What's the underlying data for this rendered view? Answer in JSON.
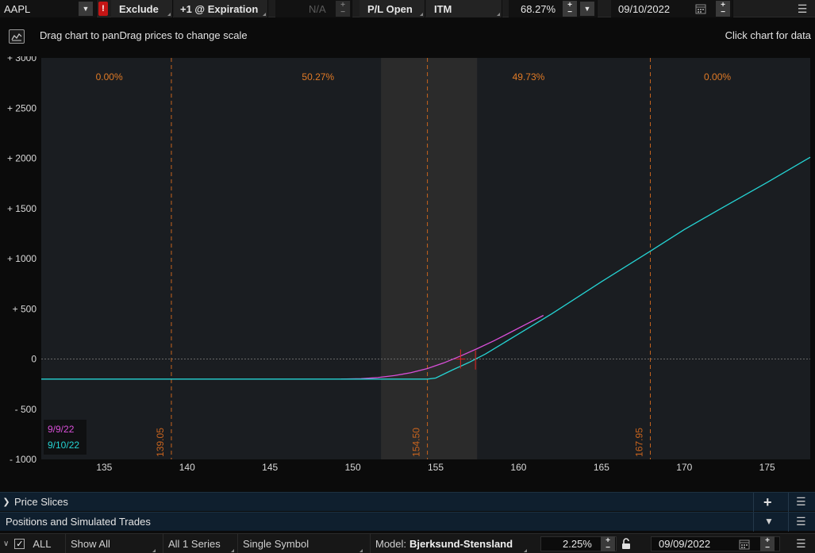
{
  "toolbar": {
    "symbol": "AAPL",
    "alert_flag": "!",
    "exclude_label": "Exclude",
    "expiration_label": "+1 @ Expiration",
    "na_value": "N/A",
    "pl_label": "P/L Open",
    "itm_label": "ITM",
    "probability_value": "68.27%",
    "date_value": "09/10/2022"
  },
  "chart_header": {
    "hint_left": "Drag chart to panDrag prices to change scale",
    "hint_right": "Click chart for data"
  },
  "chart_data": {
    "type": "line",
    "x_ticks": [
      135,
      140,
      145,
      150,
      155,
      160,
      165,
      170,
      175
    ],
    "y_ticks": [
      3000,
      2500,
      2000,
      1500,
      1000,
      500,
      0,
      -500,
      -1000
    ],
    "y_tick_labels": [
      "+ 3000",
      "+ 2500",
      "+ 2000",
      "+ 1500",
      "+ 1000",
      "+ 500",
      "0",
      "- 500",
      "- 1000"
    ],
    "xlim": [
      131.2,
      177.6
    ],
    "ylim": [
      -1000,
      3000
    ],
    "probability_labels": [
      {
        "text": "0.00%",
        "x": 135.3
      },
      {
        "text": "50.27%",
        "x": 147.9
      },
      {
        "text": "49.73%",
        "x": 160.6
      },
      {
        "text": "0.00%",
        "x": 172.0
      }
    ],
    "vertical_markers": [
      {
        "value": 139.05,
        "label": "139.05"
      },
      {
        "value": 154.5,
        "label": "154.50"
      },
      {
        "value": 167.95,
        "label": "167.95"
      }
    ],
    "shaded_range": [
      151.7,
      157.5
    ],
    "current_price": 156.5,
    "series": [
      {
        "name": "9/9/22",
        "color": "#d94fd9",
        "x": [
          149.3,
          150.5,
          151.5,
          152.5,
          153.5,
          154.5,
          155.5,
          156.5,
          157.5,
          158.5,
          159.5,
          160.5,
          161.5
        ],
        "y": [
          -200,
          -196,
          -185,
          -165,
          -137,
          -95,
          -38,
          30,
          103,
          180,
          265,
          350,
          435
        ]
      },
      {
        "name": "9/10/22",
        "color": "#25d4d4",
        "x": [
          131.2,
          150.0,
          154.5,
          155.0,
          156.0,
          157.0,
          158.0,
          160.0,
          162.0,
          165.0,
          168.0,
          170.0,
          172.0,
          175.0,
          177.6
        ],
        "y": [
          -200,
          -200,
          -200,
          -190,
          -110,
          -35,
          50,
          250,
          450,
          770,
          1080,
          1290,
          1480,
          1760,
          2010
        ]
      }
    ],
    "legend_placement": "bottom-left",
    "colors": {
      "background": "#1a1d21",
      "shaded": "#2b2b2b",
      "marker": "#c8641e",
      "probability": "#e07a26",
      "zero_line": "#6a6a6a",
      "cursor": "#e02020"
    }
  },
  "panels": {
    "price_slices": "Price Slices",
    "positions": "Positions and Simulated Trades"
  },
  "status_bar": {
    "all_label": "ALL",
    "show_all": "Show All",
    "series_label": "All 1 Series",
    "single_symbol": "Single Symbol",
    "model_prefix": "Model:",
    "model_value": "Bjerksund-Stensland",
    "rate_value": "2.25%",
    "date_value": "09/09/2022"
  }
}
